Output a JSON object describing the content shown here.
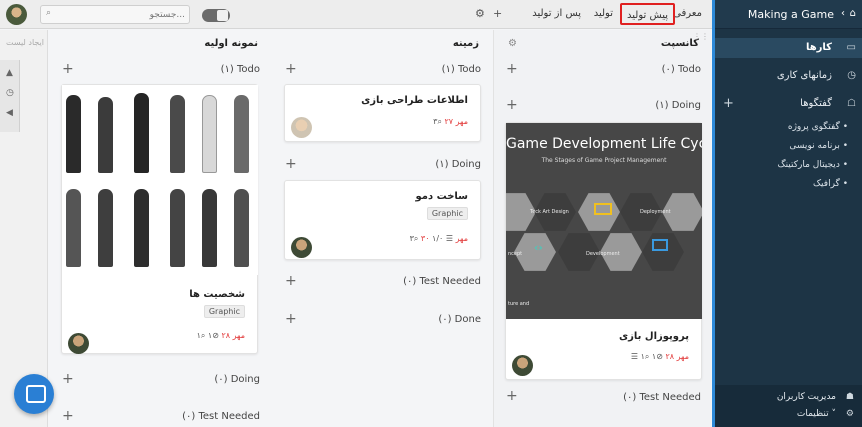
{
  "app": {
    "project_title": "Making a Game"
  },
  "topbar": {
    "tabs": [
      {
        "label": "معرفی"
      },
      {
        "label": "پیش تولید"
      },
      {
        "label": "تولید"
      },
      {
        "label": "پس از تولید"
      }
    ],
    "active_tab": "پیش تولید",
    "search_placeholder": "جستجو..."
  },
  "sidebar": {
    "items": [
      {
        "label": "کارها",
        "icon": "card-icon",
        "active": true
      },
      {
        "label": "زمانهای کاری",
        "icon": "clock-icon"
      },
      {
        "label": "گفتگوها",
        "icon": "chat-icon"
      }
    ],
    "conversations": [
      "گفتگوی پروژه",
      "برنامه نویسی",
      "دیجیتال مارکتینگ",
      "گرافیک"
    ],
    "user_management": "مدیریت کاربران",
    "settings": "تنظیمات"
  },
  "left_strip": {
    "header": "ایجاد لیست"
  },
  "columns": [
    {
      "title": "کانسپت",
      "sections": [
        {
          "label": "(۰) Todo"
        },
        {
          "label": "(۱) Doing"
        },
        {
          "label": "(۰) Test Needed"
        }
      ],
      "cards": [
        {
          "title": "پروپوزال بازی",
          "image_title": "Game Development Life Cycle",
          "image_subtitle": "The Stages of Game Project Management",
          "image_labels": [
            "Teck Art Design",
            "Deployment",
            "Development",
            "ncept",
            "ture and"
          ],
          "comments": "۱",
          "attachments": "۱",
          "due": "۲۸ مهر"
        }
      ]
    },
    {
      "title": "زمینه",
      "sections": [
        {
          "label": "(۱) Todo"
        },
        {
          "label": "(۱) Doing"
        },
        {
          "label": "(۰) Test Needed"
        },
        {
          "label": "(۰) Done"
        }
      ],
      "cards": [
        {
          "title": "اطلاعات طراحی بازی",
          "comments": "۳",
          "due": "۲۷ مهر"
        },
        {
          "title": "ساخت دمو",
          "tag": "Graphic",
          "comments": "۳",
          "checklist": "۱/۰",
          "due": "۳۰ مهر"
        }
      ]
    },
    {
      "title": "نمونه اولیه",
      "sections": [
        {
          "label": "(۱) Todo"
        },
        {
          "label": "(۰) Doing"
        },
        {
          "label": "(۰) Test Needed"
        }
      ],
      "cards": [
        {
          "title": "شخصیت ها",
          "tag": "Graphic",
          "comments": "۱",
          "attachments": "۱",
          "due": "۲۸ مهر"
        }
      ]
    }
  ],
  "colors": {
    "sidebar_bg": "#1d3445",
    "accent": "#2e8ad8",
    "due": "#e23b3b",
    "active_tab_border": "#e02020"
  }
}
